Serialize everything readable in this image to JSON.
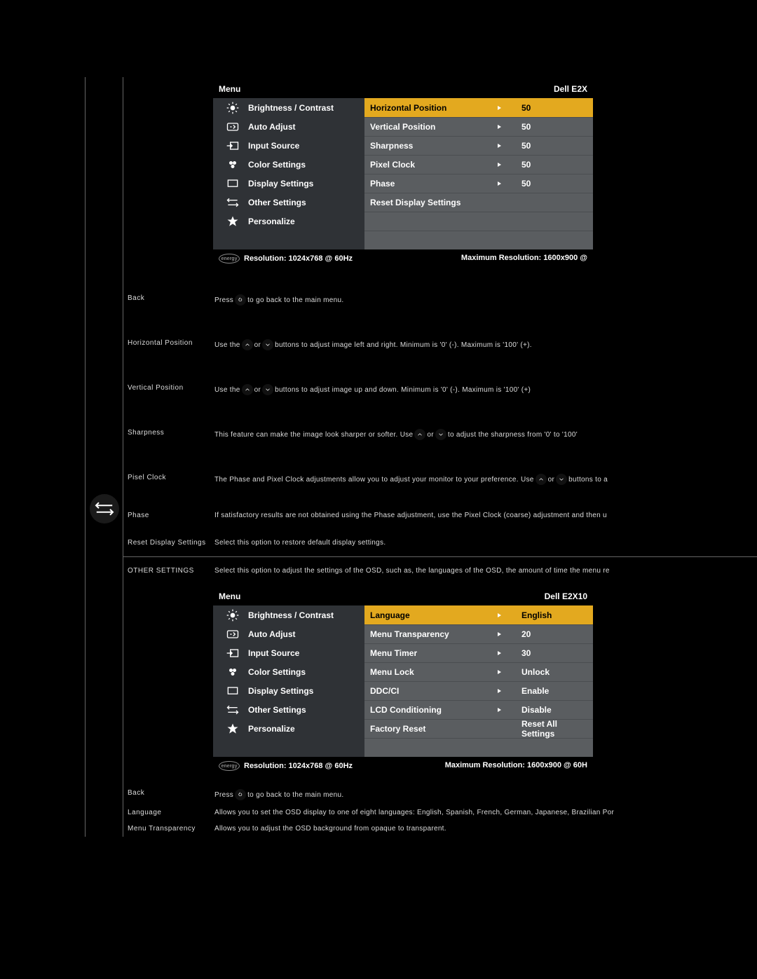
{
  "osd_common": {
    "menu_label": "Menu",
    "resolution_label": "Resolution: 1024x768 @ 60Hz",
    "left_items": [
      "Brightness / Contrast",
      "Auto Adjust",
      "Input Source",
      "Color Settings",
      "Display Settings",
      "Other Settings",
      "Personalize"
    ]
  },
  "osd1": {
    "model": "Dell E2X",
    "max_res": "Maximum Resolution: 1600x900 @",
    "options": [
      {
        "label": "Horizontal Position",
        "value": "50",
        "arrow": true,
        "selected": true
      },
      {
        "label": "Vertical Position",
        "value": "50",
        "arrow": true
      },
      {
        "label": "Sharpness",
        "value": "50",
        "arrow": true
      },
      {
        "label": "Pixel Clock",
        "value": "50",
        "arrow": true
      },
      {
        "label": "Phase",
        "value": "50",
        "arrow": true
      },
      {
        "label": "Reset Display Settings",
        "value": "",
        "arrow": false
      },
      {
        "label": "",
        "value": "",
        "arrow": false
      },
      {
        "label": "",
        "value": "",
        "arrow": false
      }
    ]
  },
  "osd2": {
    "model": "Dell E2X10",
    "max_res": "Maximum Resolution: 1600x900 @ 60H",
    "options": [
      {
        "label": "Language",
        "value": "English",
        "arrow": true,
        "selected": true
      },
      {
        "label": "Menu Transparency",
        "value": "20",
        "arrow": true
      },
      {
        "label": "Menu Timer",
        "value": "30",
        "arrow": true
      },
      {
        "label": "Menu Lock",
        "value": "Unlock",
        "arrow": true
      },
      {
        "label": "DDC/CI",
        "value": "Enable",
        "arrow": true
      },
      {
        "label": "LCD Conditioning",
        "value": "Disable",
        "arrow": true
      },
      {
        "label": "Factory Reset",
        "value": "Reset All Settings",
        "arrow": false
      },
      {
        "label": "",
        "value": "",
        "arrow": false
      }
    ]
  },
  "rows1": [
    {
      "label": "Back",
      "pre": "Press",
      "icon": "back",
      "post": " to go back to the main menu."
    },
    {
      "label": "Horizontal Position",
      "pre": "Use the ",
      "icon": "updown",
      "post": " buttons to adjust image left and right. Minimum is '0' (-). Maximum is '100' (+)."
    },
    {
      "label": "Vertical Position",
      "pre": "Use the ",
      "icon": "updown",
      "post": " buttons to adjust image up and down. Minimum is '0' (-). Maximum is '100' (+)"
    },
    {
      "label": "Sharpness",
      "pre": "This feature can make the image look sharper or softer. Use ",
      "icon": "updown",
      "post": " to adjust the sharpness from '0' to '100'"
    },
    {
      "label": "Pisel Clock",
      "pre": "The Phase and Pixel Clock adjustments allow you to adjust your monitor to your preference. Use ",
      "icon": "updown",
      "post": " buttons to a"
    },
    {
      "label": "Phase",
      "pre": "If satisfactory results are not obtained using the Phase adjustment, use the Pixel Clock (coarse) adjustment and then u",
      "icon": "",
      "post": ""
    },
    {
      "label": "Reset Display Settings",
      "pre": "Select this option to restore default display settings.",
      "icon": "",
      "post": ""
    }
  ],
  "section2_header": {
    "label": "OTHER SETTINGS",
    "desc": "Select this option to adjust the settings of the OSD, such as, the languages of the OSD, the amount of time the menu re"
  },
  "rows2": [
    {
      "label": "Back",
      "pre": "Press",
      "icon": "back",
      "post": " to go back to the main menu."
    },
    {
      "label": "Language",
      "pre": "Allows you to set the OSD display to one of eight languages: English, Spanish, French, German, Japanese, Brazilian Por",
      "icon": "",
      "post": ""
    },
    {
      "label": "Menu Transparency",
      "pre": "Allows you to adjust the OSD background from opaque to transparent.",
      "icon": "",
      "post": ""
    }
  ]
}
